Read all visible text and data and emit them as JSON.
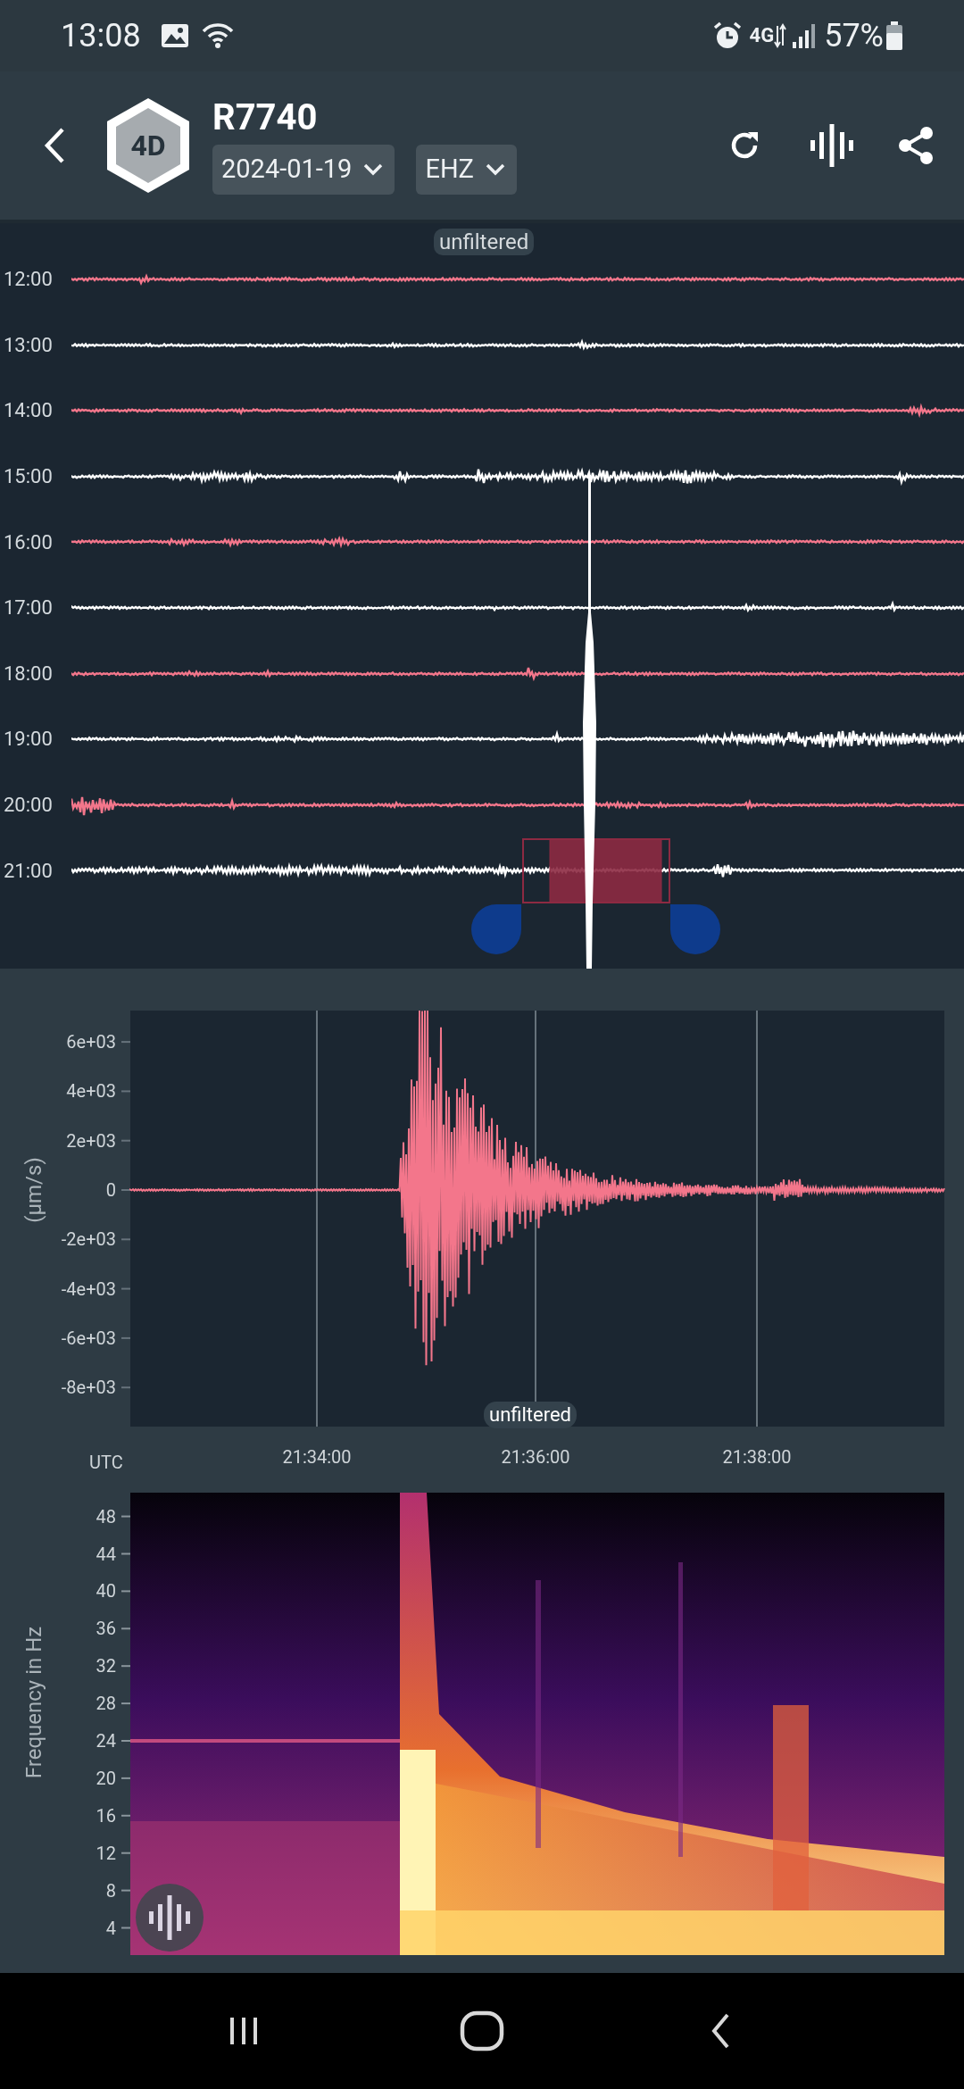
{
  "status_bar": {
    "time": "13:08",
    "network": "4G",
    "battery": "57%"
  },
  "header": {
    "logo": "4D",
    "title": "R7740",
    "date_selector": {
      "value": "2024-01-19"
    },
    "channel_selector": {
      "value": "EHZ"
    }
  },
  "helicorder": {
    "badge": "unfiltered",
    "rows": [
      {
        "time": "12:00",
        "color": "#f3768b"
      },
      {
        "time": "13:00",
        "color": "#ffffff"
      },
      {
        "time": "14:00",
        "color": "#f3768b"
      },
      {
        "time": "15:00",
        "color": "#ffffff"
      },
      {
        "time": "16:00",
        "color": "#f3768b"
      },
      {
        "time": "17:00",
        "color": "#ffffff"
      },
      {
        "time": "18:00",
        "color": "#f3768b"
      },
      {
        "time": "19:00",
        "color": "#ffffff"
      },
      {
        "time": "20:00",
        "color": "#f3768b"
      },
      {
        "time": "21:00",
        "color": "#ffffff"
      }
    ]
  },
  "waveform_chart": {
    "badge": "unfiltered",
    "y_label": "(µm/s)",
    "y_ticks": [
      "6e+03",
      "4e+03",
      "2e+03",
      "0",
      "-2e+03",
      "-4e+03",
      "-6e+03",
      "-8e+03"
    ],
    "x_label": "UTC",
    "x_ticks": [
      "21:34:00",
      "21:36:00",
      "21:38:00"
    ]
  },
  "spectrogram": {
    "y_label": "Frequency in Hz",
    "y_ticks": [
      "48",
      "44",
      "40",
      "36",
      "32",
      "28",
      "24",
      "20",
      "16",
      "12",
      "8",
      "4"
    ]
  }
}
